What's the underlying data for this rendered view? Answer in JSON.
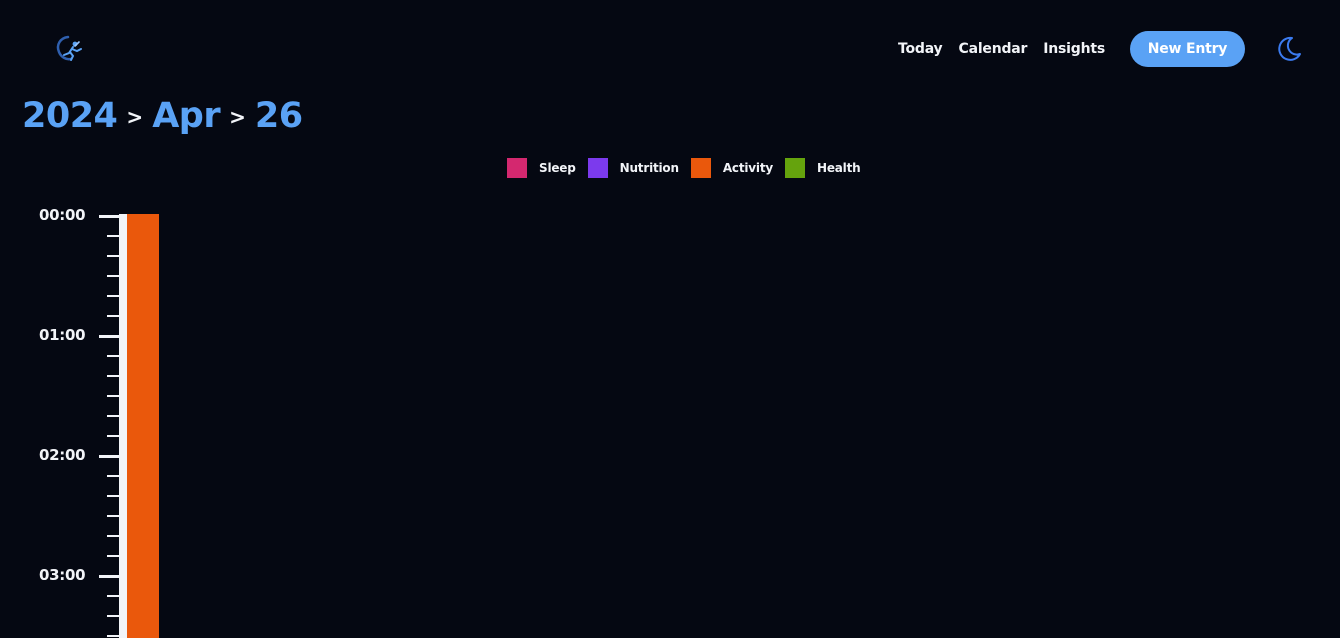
{
  "header": {
    "logo_icon": "runner-logo-icon",
    "nav": [
      {
        "label": "Today"
      },
      {
        "label": "Calendar"
      },
      {
        "label": "Insights"
      }
    ],
    "new_entry_label": "New Entry",
    "theme_icon": "moon-icon"
  },
  "breadcrumb": {
    "year": "2024",
    "month": "Apr",
    "day": "26",
    "separator": ">"
  },
  "legend": [
    {
      "label": "Sleep",
      "color": "#d4286f"
    },
    {
      "label": "Nutrition",
      "color": "#7c3aed"
    },
    {
      "label": "Activity",
      "color": "#ea580c"
    },
    {
      "label": "Health",
      "color": "#65a30d"
    }
  ],
  "timeline": {
    "hours": [
      "00:00",
      "01:00",
      "02:00",
      "03:00"
    ],
    "entries": [
      {
        "category": "Activity",
        "color": "#ea580c"
      }
    ]
  },
  "colors": {
    "background": "#050812",
    "accent": "#5aa2f5",
    "text": "#f2f4f8"
  }
}
